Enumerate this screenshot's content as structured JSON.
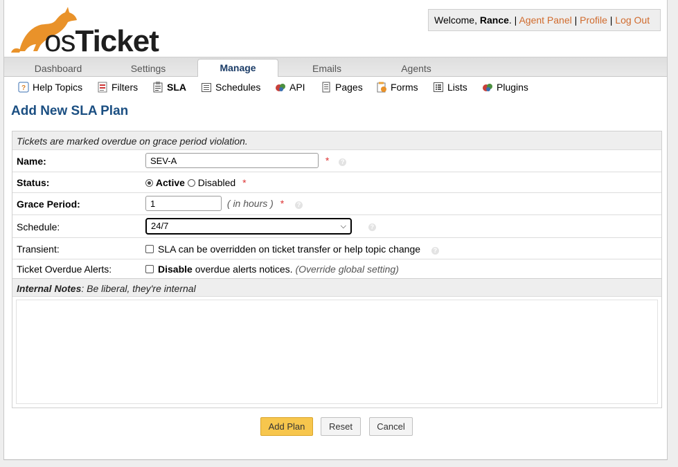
{
  "brand": {
    "logo_text_os": "os",
    "logo_text_ticket": "Ticket",
    "accent": "#e9922a"
  },
  "userbox": {
    "welcome": "Welcome, ",
    "user": "Rance",
    "sep1": ". | ",
    "agent_panel": "Agent Panel",
    "sep2": " | ",
    "profile": "Profile",
    "sep3": " | ",
    "logout": "Log Out"
  },
  "nav": {
    "tabs": [
      {
        "label": "Dashboard"
      },
      {
        "label": "Settings"
      },
      {
        "label": "Manage",
        "active": true
      },
      {
        "label": "Emails"
      },
      {
        "label": "Agents"
      }
    ]
  },
  "subnav": {
    "items": [
      {
        "label": "Help Topics",
        "icon": "help-topics-icon"
      },
      {
        "label": "Filters",
        "icon": "filters-icon"
      },
      {
        "label": "SLA",
        "icon": "sla-icon",
        "active": true
      },
      {
        "label": "Schedules",
        "icon": "schedules-icon"
      },
      {
        "label": "API",
        "icon": "api-icon"
      },
      {
        "label": "Pages",
        "icon": "pages-icon"
      },
      {
        "label": "Forms",
        "icon": "forms-icon"
      },
      {
        "label": "Lists",
        "icon": "lists-icon"
      },
      {
        "label": "Plugins",
        "icon": "plugins-icon"
      }
    ]
  },
  "page_title": "Add New SLA Plan",
  "form": {
    "header_note": "Tickets are marked overdue on grace period violation.",
    "name": {
      "label": "Name:",
      "value": "SEV-A",
      "required": "*"
    },
    "status": {
      "label": "Status:",
      "active_label": "Active",
      "disabled_label": "Disabled",
      "selected": "Active",
      "required": "*"
    },
    "grace": {
      "label": "Grace Period:",
      "value": "1",
      "unit": "( in hours )",
      "required": "*"
    },
    "schedule": {
      "label": "Schedule:",
      "value": "24/7"
    },
    "transient": {
      "label": "Transient:",
      "checkbox_label": "SLA can be overridden on ticket transfer or help topic change"
    },
    "overdue": {
      "label": "Ticket Overdue Alerts:",
      "bold": "Disable",
      "rest": " overdue alerts notices. ",
      "hint": "(Override global setting)"
    },
    "notes": {
      "bold": "Internal Notes",
      "rest": ": Be liberal, they're internal",
      "value": ""
    }
  },
  "buttons": {
    "add": "Add Plan",
    "reset": "Reset",
    "cancel": "Cancel"
  }
}
